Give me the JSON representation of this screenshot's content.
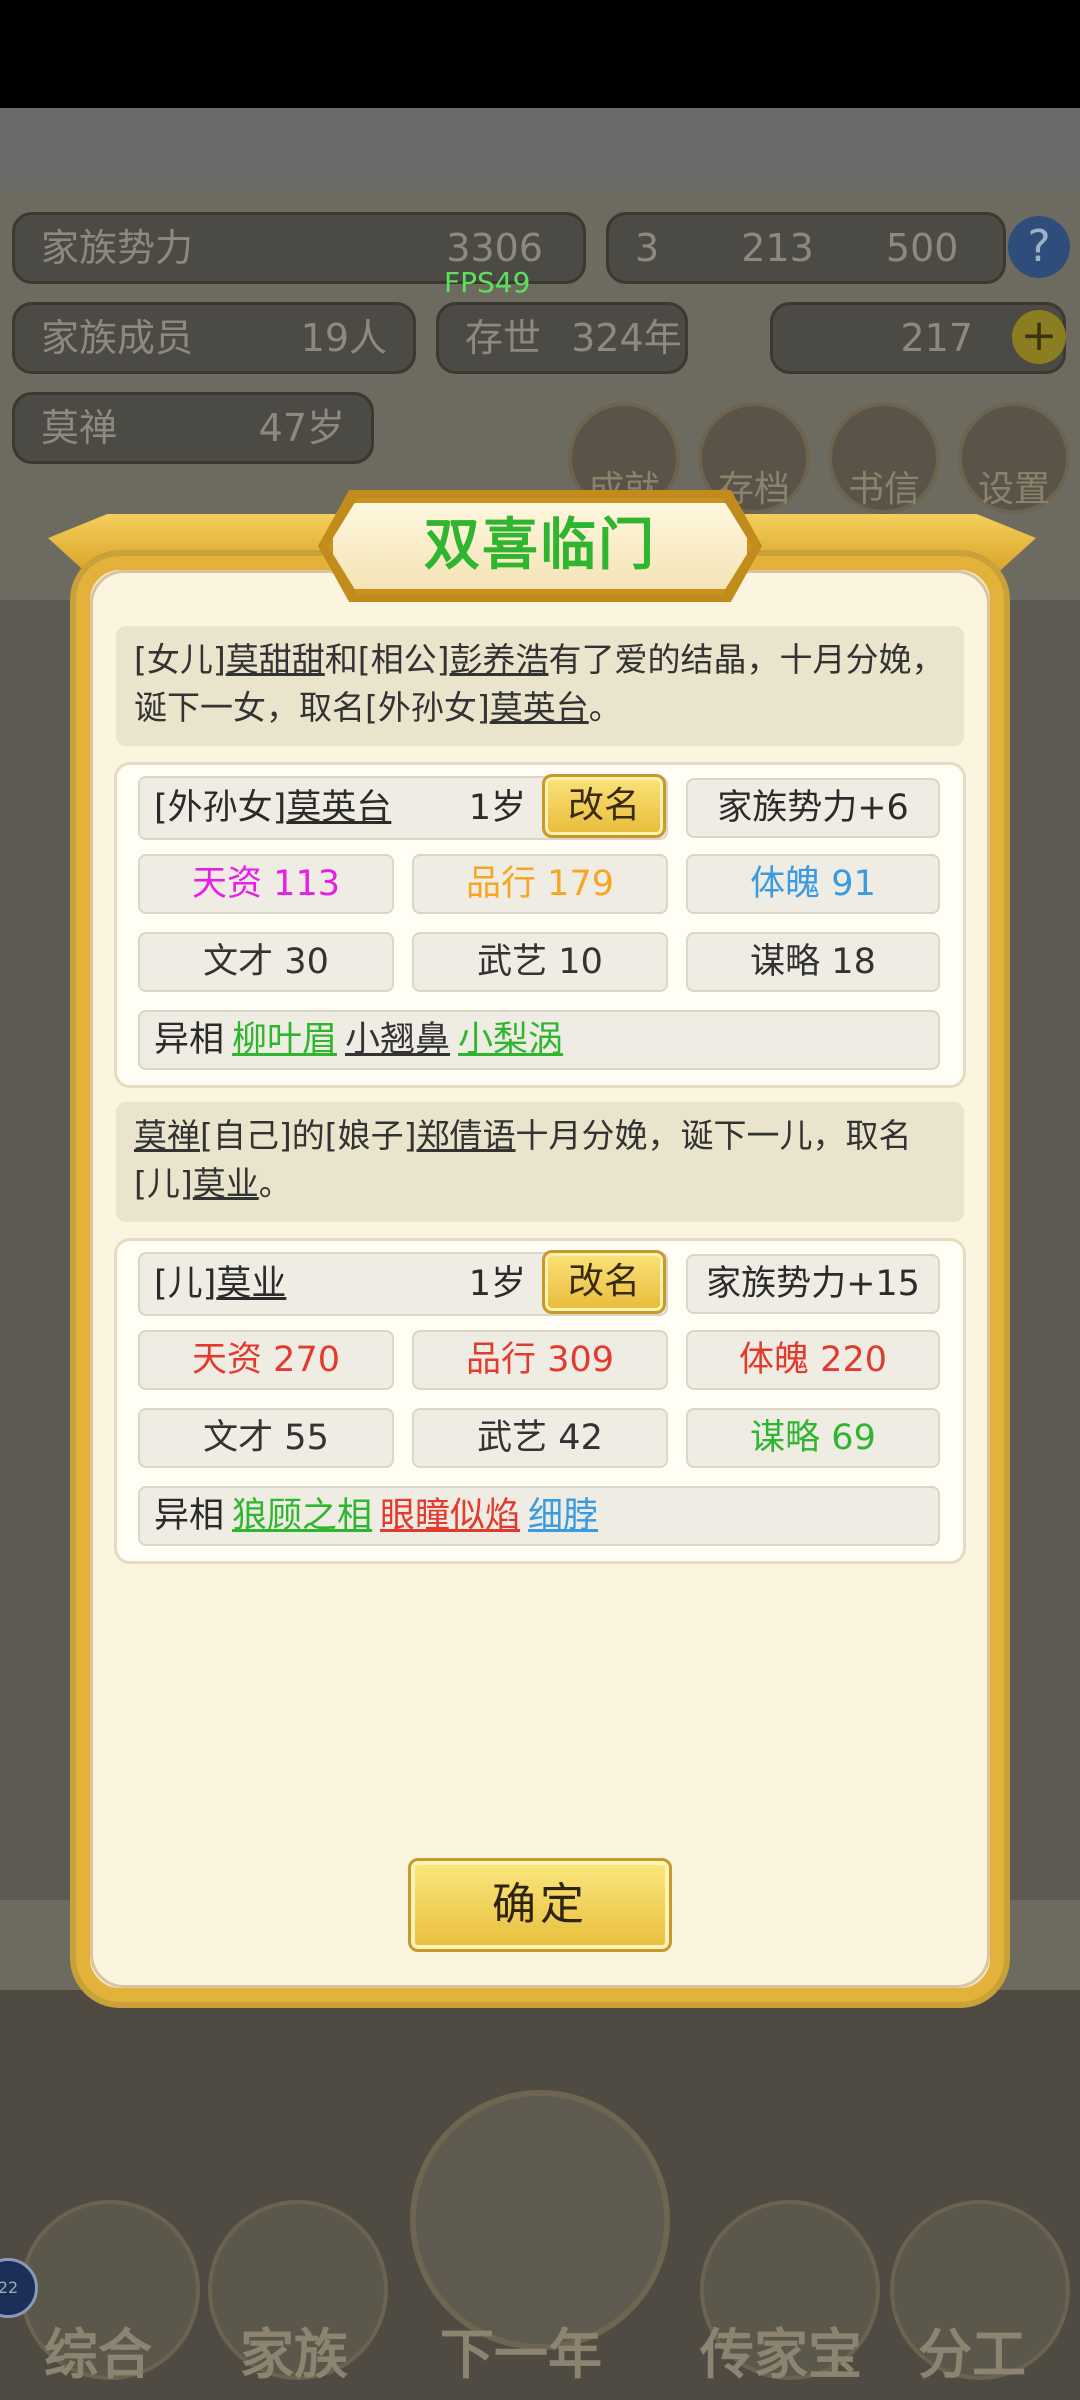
{
  "background": {
    "stats": {
      "family_power_label": "家族势力",
      "family_power_value": "3306",
      "resources_text": "3",
      "gold_bars": "213",
      "silver": "500",
      "members_label": "家族成员",
      "members_value": "19人",
      "generation_label": "存世",
      "generation_value": "324年",
      "ingots": "217",
      "leader_name": "莫禅",
      "leader_age": "47岁"
    },
    "fps": "FPS49",
    "top_buttons": [
      "成就",
      "存档",
      "书信",
      "设置"
    ],
    "nav": {
      "items": [
        "综合",
        "家族",
        "下一年",
        "传家宝",
        "分工"
      ]
    }
  },
  "modal": {
    "title": "双喜临门",
    "events": [
      {
        "message_parts": [
          "[女儿]",
          "莫甜甜",
          "和[相公]",
          "彭养浩",
          "有了爱的结晶，十月分娩，诞下一女，取名[外孙女]",
          "莫英台",
          "。"
        ],
        "child": {
          "relation": "[外孙女]",
          "name": "莫英台",
          "age": "1岁",
          "rename_label": "改名",
          "power_bonus": "家族势力+6",
          "stats": [
            {
              "label": "天资",
              "value": "113",
              "color": "#e61ee6"
            },
            {
              "label": "品行",
              "value": "179",
              "color": "#f5a623"
            },
            {
              "label": "体魄",
              "value": "91",
              "color": "#3a9be0"
            },
            {
              "label": "文才",
              "value": "30",
              "color": "#333333"
            },
            {
              "label": "武艺",
              "value": "10",
              "color": "#333333"
            },
            {
              "label": "谋略",
              "value": "18",
              "color": "#333333"
            }
          ],
          "traits_label": "异相",
          "traits": [
            {
              "text": "柳叶眉",
              "color": "#2fb52f"
            },
            {
              "text": "小翘鼻",
              "color": "#333333"
            },
            {
              "text": "小梨涡",
              "color": "#2fb52f"
            }
          ]
        }
      },
      {
        "message_parts": [
          "莫禅",
          "[自己]的[娘子]",
          "郑倩语",
          "十月分娩，诞下一儿，取名[儿]",
          "莫业",
          "。"
        ],
        "child": {
          "relation": "[儿]",
          "name": "莫业",
          "age": "1岁",
          "rename_label": "改名",
          "power_bonus": "家族势力+15",
          "stats": [
            {
              "label": "天资",
              "value": "270",
              "color": "#e23b2e"
            },
            {
              "label": "品行",
              "value": "309",
              "color": "#e23b2e"
            },
            {
              "label": "体魄",
              "value": "220",
              "color": "#e23b2e"
            },
            {
              "label": "文才",
              "value": "55",
              "color": "#333333"
            },
            {
              "label": "武艺",
              "value": "42",
              "color": "#333333"
            },
            {
              "label": "谋略",
              "value": "69",
              "color": "#2fb52f"
            }
          ],
          "traits_label": "异相",
          "traits": [
            {
              "text": "狼顾之相",
              "color": "#2fb52f"
            },
            {
              "text": "眼瞳似焰",
              "color": "#e23b2e"
            },
            {
              "text": "细脖",
              "color": "#3a9be0"
            }
          ]
        }
      }
    ],
    "confirm_label": "确定"
  }
}
